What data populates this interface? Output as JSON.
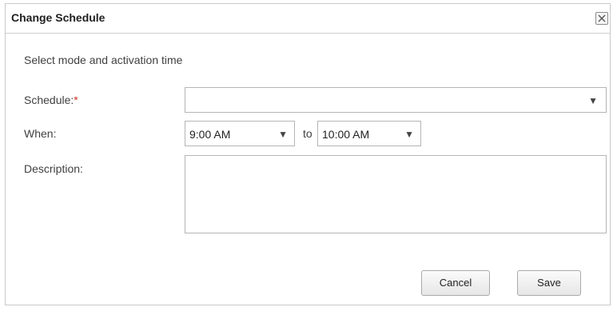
{
  "dialog": {
    "title": "Change Schedule",
    "close_icon": "close-icon",
    "subtitle": "Select mode and activation time"
  },
  "form": {
    "schedule": {
      "label": "Schedule:",
      "required_marker": "*",
      "value": ""
    },
    "when": {
      "label": "When:",
      "from_value": "9:00 AM",
      "to_label": "to",
      "to_value": "10:00 AM"
    },
    "description": {
      "label": "Description:",
      "value": ""
    }
  },
  "buttons": {
    "cancel_label": "Cancel",
    "save_label": "Save"
  },
  "colors": {
    "required": "#d0352f",
    "border": "#b5b5b5"
  }
}
